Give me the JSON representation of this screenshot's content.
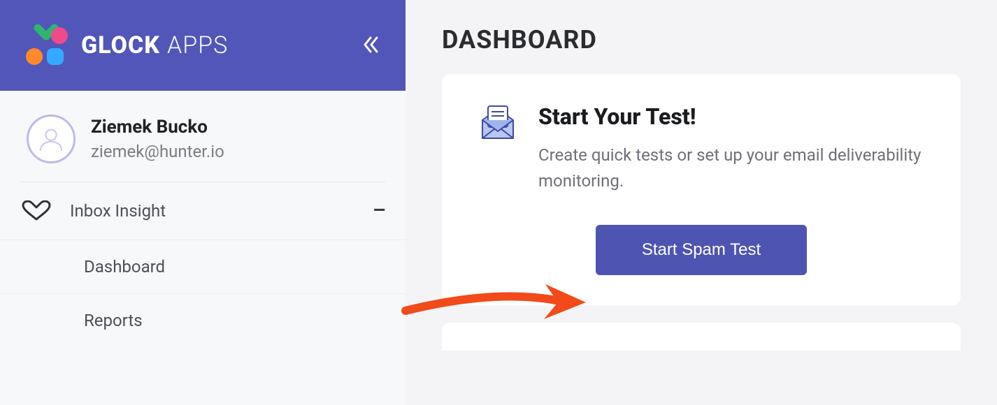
{
  "brand": {
    "name_bold": "GLOCK",
    "name_light": "APPS"
  },
  "user": {
    "name": "Ziemek Bucko",
    "email": "ziemek@hunter.io"
  },
  "sidebar": {
    "section_label": "Inbox Insight",
    "items": [
      {
        "label": "Dashboard"
      },
      {
        "label": "Reports"
      }
    ]
  },
  "page": {
    "title": "DASHBOARD",
    "card": {
      "title": "Start Your Test!",
      "description": "Create quick tests or set up your email deliverability monitoring.",
      "cta": "Start Spam Test"
    }
  },
  "colors": {
    "accent": "#4e54b1",
    "header": "#5256b9"
  }
}
